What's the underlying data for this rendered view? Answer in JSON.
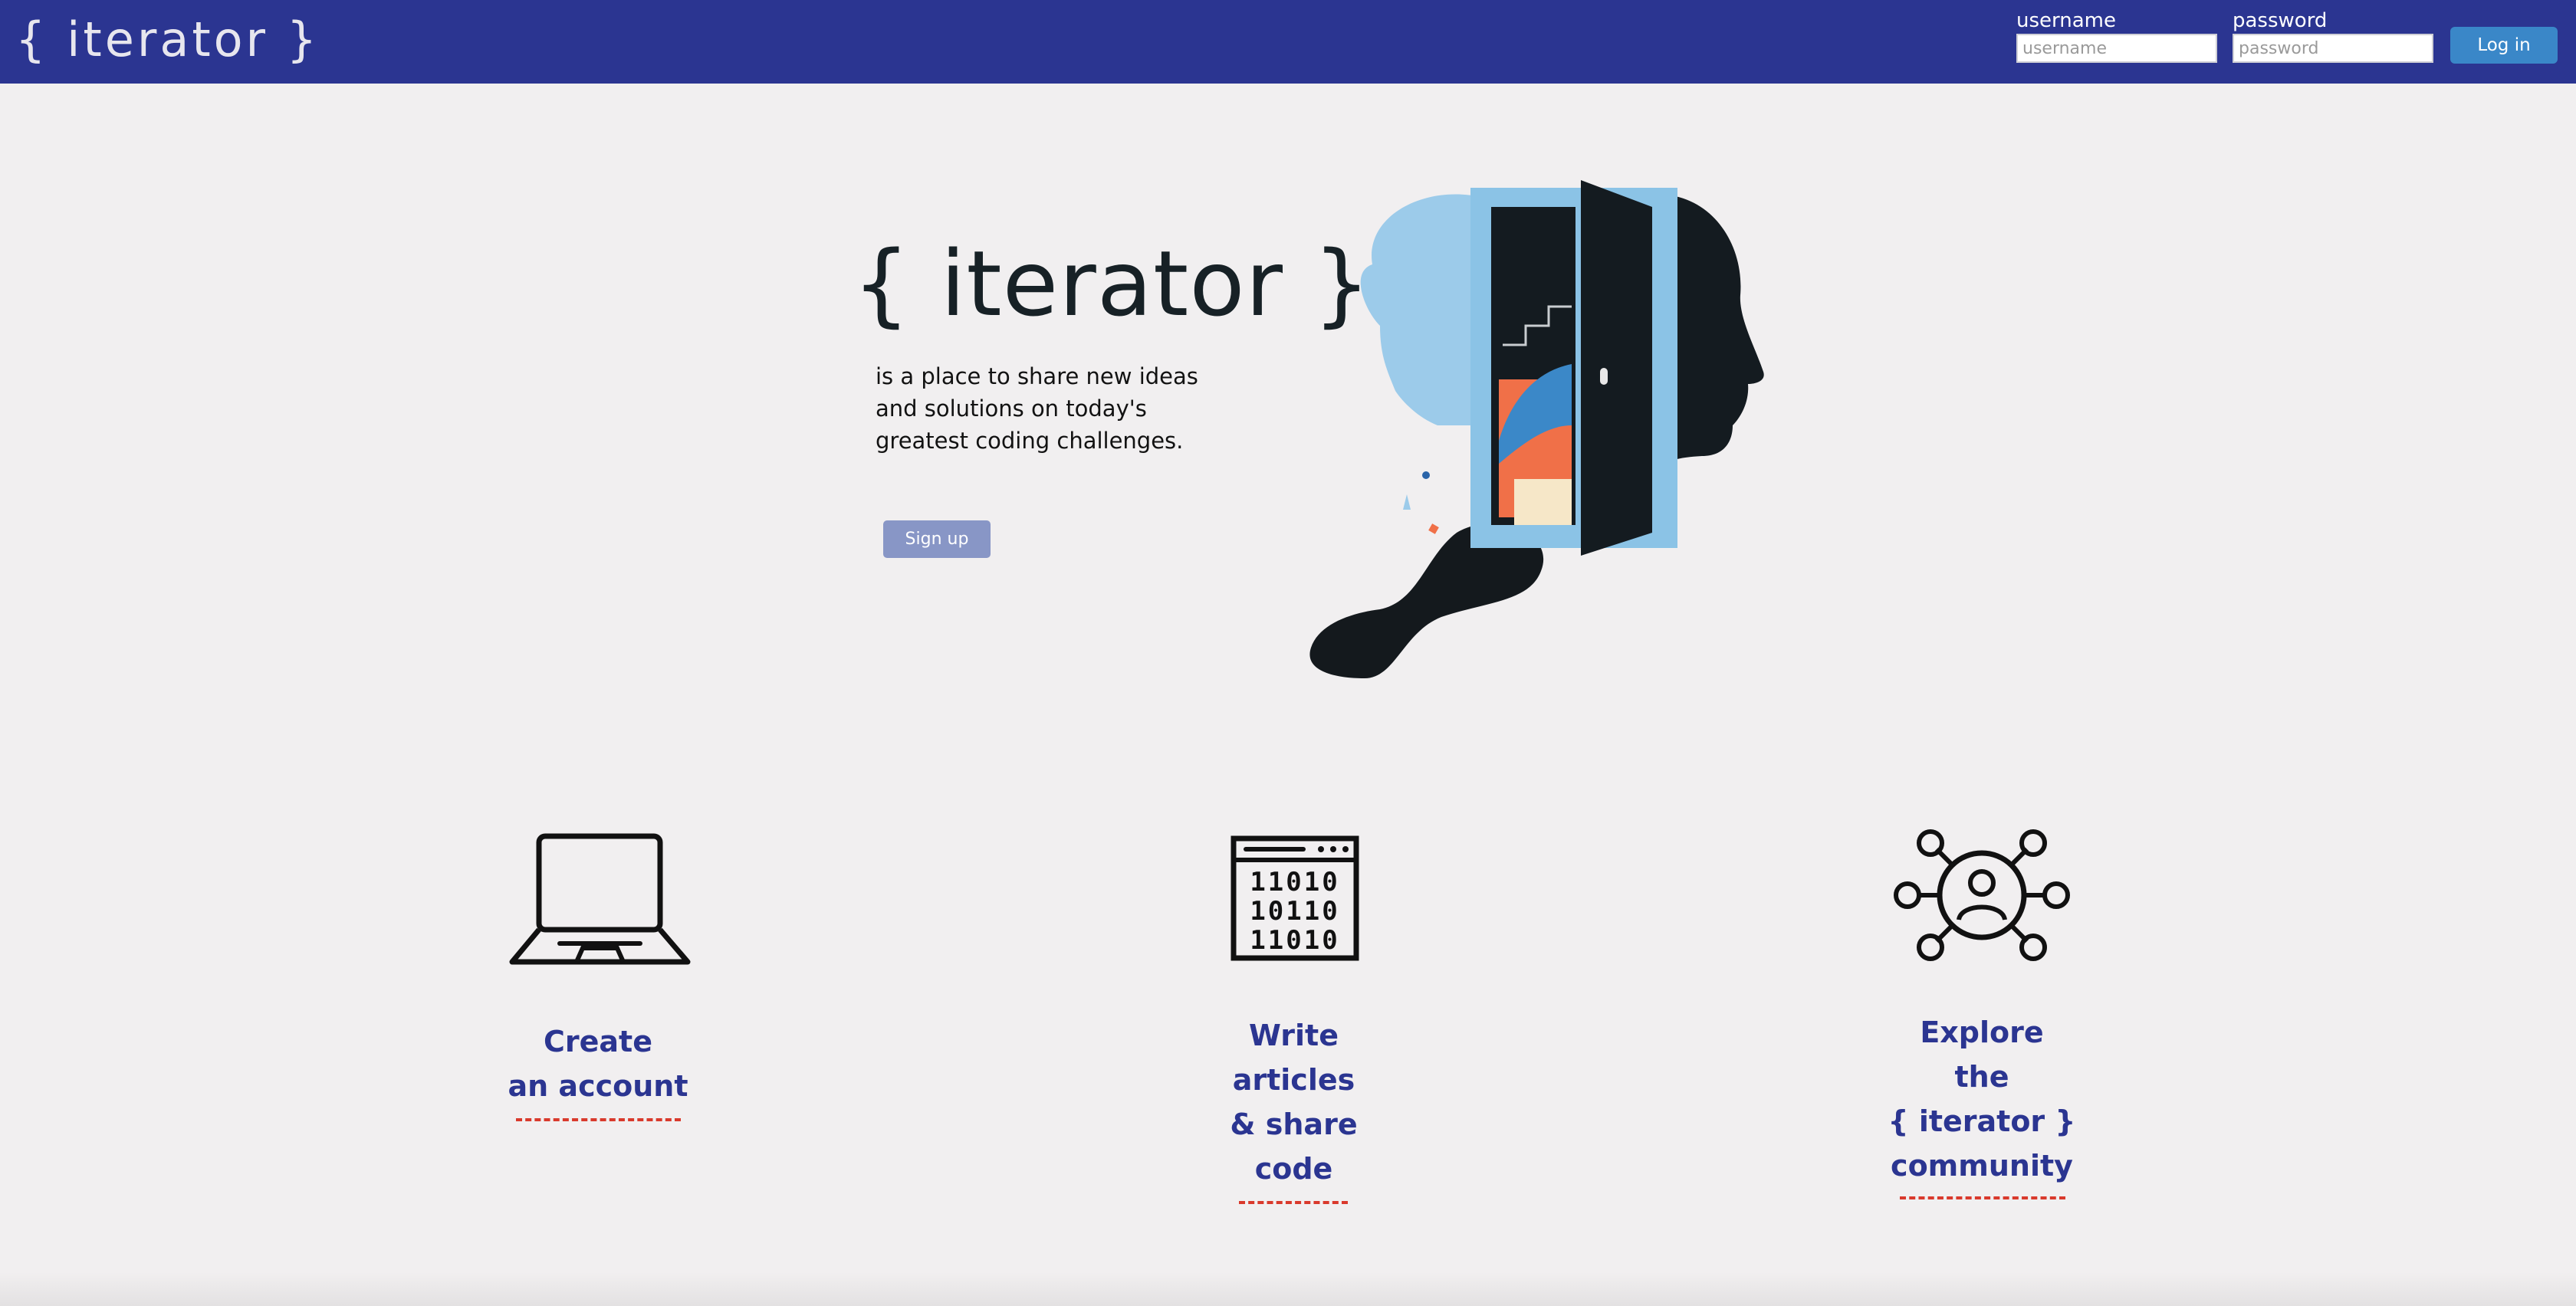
{
  "navbar": {
    "brand": "{ iterator }",
    "username_label": "username",
    "username_placeholder": "username",
    "password_label": "password",
    "password_placeholder": "password",
    "login_label": "Log in",
    "color": "#2b3591"
  },
  "hero": {
    "logo": "{ iterator }",
    "tagline_lines": [
      "is a place to share new ideas",
      "and solutions on today's",
      "greatest coding challenges."
    ],
    "signup_label": "Sign up"
  },
  "features": [
    {
      "icon": "laptop-icon",
      "lines": [
        "Create",
        "an account"
      ]
    },
    {
      "icon": "binary-code-window-icon",
      "code_rows": [
        "11010",
        "10110",
        "11010"
      ],
      "lines": [
        "Write",
        "articles",
        "& share",
        "code"
      ]
    },
    {
      "icon": "community-network-icon",
      "lines": [
        "Explore",
        "the",
        "{ iterator }",
        "community"
      ]
    }
  ],
  "colors": {
    "accent": "#2b3591",
    "button": "#3a87c8",
    "signup": "#8896c6",
    "underline": "#d9392c",
    "background": "#f1eff0"
  }
}
